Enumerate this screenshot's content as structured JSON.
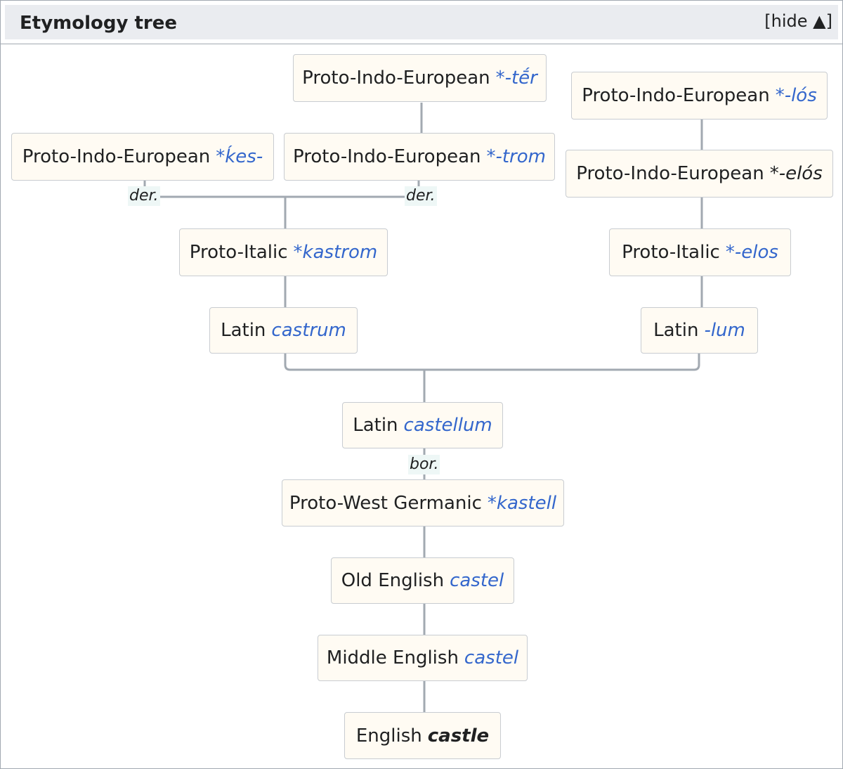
{
  "header": {
    "title": "Etymology tree",
    "toggle": "[hide ▲]"
  },
  "nodes": {
    "pie_ter": {
      "lang": "Proto-Indo-European",
      "term": "*-tḗr"
    },
    "pie_los": {
      "lang": "Proto-Indo-European",
      "term": "*-lós"
    },
    "pie_kes": {
      "lang": "Proto-Indo-European",
      "term": "*ḱes-"
    },
    "pie_trom": {
      "lang": "Proto-Indo-European",
      "term": "*-trom"
    },
    "pie_elos": {
      "lang": "Proto-Indo-European",
      "term": "*-elós"
    },
    "pi_kastrom": {
      "lang": "Proto-Italic",
      "term": "*kastrom"
    },
    "pi_elos": {
      "lang": "Proto-Italic",
      "term": "*-elos"
    },
    "lat_castrum": {
      "lang": "Latin",
      "term": "castrum"
    },
    "lat_lum": {
      "lang": "Latin",
      "term": "-lum"
    },
    "lat_castellum": {
      "lang": "Latin",
      "term": "castellum"
    },
    "pwg_kastell": {
      "lang": "Proto-West Germanic",
      "term": "*kastell"
    },
    "oe_castel": {
      "lang": "Old English",
      "term": "castel"
    },
    "me_castel": {
      "lang": "Middle English",
      "term": "castel"
    },
    "en_castle": {
      "lang": "English",
      "term": "castle"
    }
  },
  "relations": {
    "der_kes": "der.",
    "der_trom": "der.",
    "bor_castellum": "bor."
  },
  "colors": {
    "link": "#3366cc",
    "node_bg": "#fffbf3",
    "node_border": "#c8ccd1",
    "header_bg": "#eaecf0",
    "line": "#a2a9b1"
  }
}
